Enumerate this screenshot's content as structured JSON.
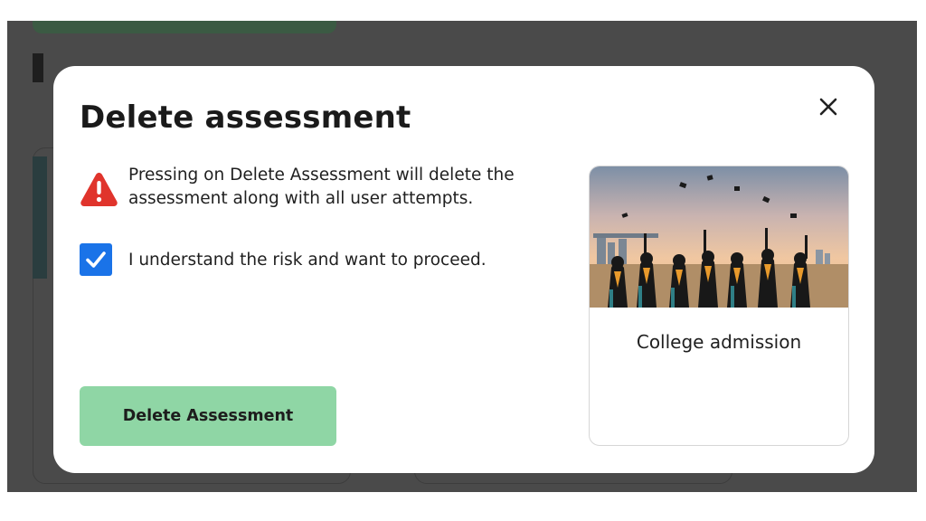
{
  "dialog": {
    "title": "Delete assessment",
    "warning_text": "Pressing on Delete Assessment will delete the assessment along with all user attempts.",
    "confirm_checkbox": {
      "label": "I understand the risk and want to proceed.",
      "checked": true
    },
    "delete_button_label": "Delete Assessment",
    "close_icon": "close-icon"
  },
  "assessment_card": {
    "title": "College admission",
    "image": "graduates-throwing-caps"
  },
  "colors": {
    "overlay": "#4a4a4a",
    "warning_red": "#e0342c",
    "checkbox_blue": "#1a73e8",
    "delete_button_green": "#8fd6a5"
  }
}
